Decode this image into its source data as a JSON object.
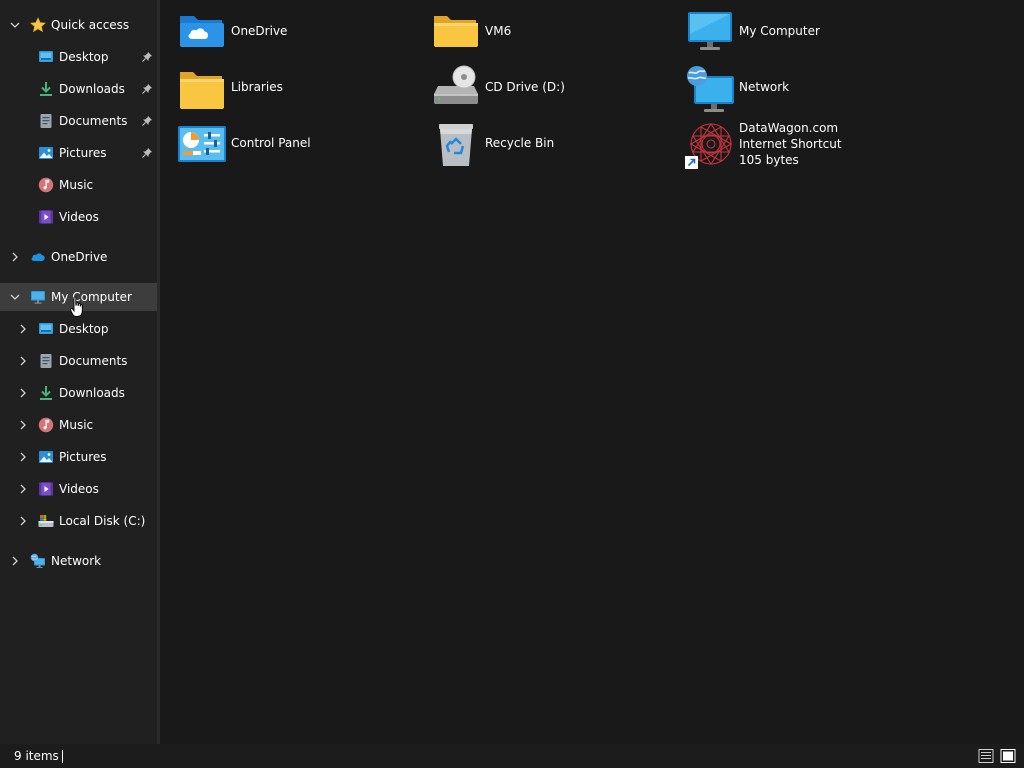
{
  "nav": {
    "quick_access": {
      "label": "Quick access",
      "icon": "star-icon",
      "expanded": true
    },
    "quick_items": [
      {
        "label": "Desktop",
        "icon": "desktop-icon",
        "pinned": true
      },
      {
        "label": "Downloads",
        "icon": "downloads-icon",
        "pinned": true
      },
      {
        "label": "Documents",
        "icon": "documents-icon",
        "pinned": true
      },
      {
        "label": "Pictures",
        "icon": "pictures-icon",
        "pinned": true
      },
      {
        "label": "Music",
        "icon": "music-icon",
        "pinned": false
      },
      {
        "label": "Videos",
        "icon": "videos-icon",
        "pinned": false
      }
    ],
    "onedrive": {
      "label": "OneDrive",
      "icon": "onedrive-icon",
      "expanded": false
    },
    "my_computer": {
      "label": "My Computer",
      "icon": "computer-icon",
      "expanded": true,
      "selected": true
    },
    "computer_items": [
      {
        "label": "Desktop",
        "icon": "desktop-icon"
      },
      {
        "label": "Documents",
        "icon": "documents-icon"
      },
      {
        "label": "Downloads",
        "icon": "downloads-icon"
      },
      {
        "label": "Music",
        "icon": "music-icon"
      },
      {
        "label": "Pictures",
        "icon": "pictures-icon"
      },
      {
        "label": "Videos",
        "icon": "videos-icon"
      },
      {
        "label": "Local Disk (C:)",
        "icon": "local-disk-icon"
      }
    ],
    "network": {
      "label": "Network",
      "icon": "network-icon",
      "expanded": false
    }
  },
  "items": [
    {
      "name": "OneDrive",
      "icon": "onedrive-folder-icon"
    },
    {
      "name": "VM6",
      "icon": "folder-icon"
    },
    {
      "name": "My Computer",
      "icon": "monitor-icon"
    },
    {
      "name": "Libraries",
      "icon": "folder-icon"
    },
    {
      "name": "CD Drive (D:)",
      "icon": "cd-drive-icon"
    },
    {
      "name": "Network",
      "icon": "network-icon"
    },
    {
      "name": "Control Panel",
      "icon": "control-panel-icon"
    },
    {
      "name": "Recycle Bin",
      "icon": "recycle-bin-icon"
    },
    {
      "name": "DataWagon.com",
      "type": "Internet Shortcut",
      "size": "105 bytes",
      "icon": "internet-shortcut-icon"
    }
  ],
  "status": {
    "count": "9 items"
  },
  "colors": {
    "background": "#191919",
    "sidebar": "#202020",
    "selected_row": "#3d3d3d",
    "folder_yellow": "#f8c640",
    "accent_blue": "#1e90e0"
  }
}
